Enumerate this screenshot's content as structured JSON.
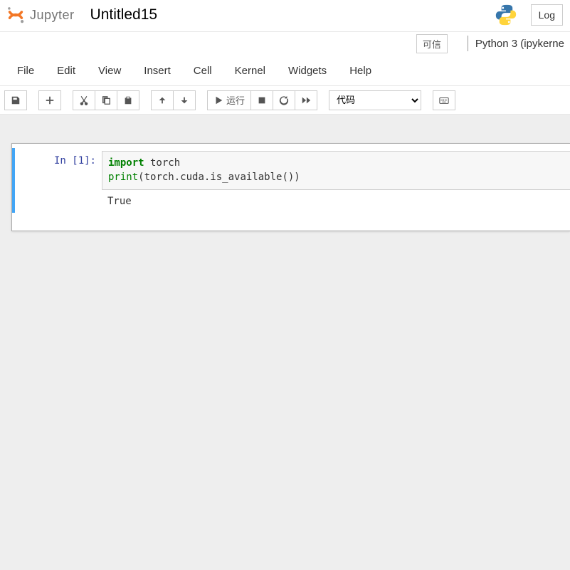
{
  "header": {
    "logo_text": "Jupyter",
    "title": "Untitled15",
    "login_label": "Log"
  },
  "status": {
    "trust": "可信",
    "kernel": "Python 3 (ipykerne"
  },
  "menubar": [
    "File",
    "Edit",
    "View",
    "Insert",
    "Cell",
    "Kernel",
    "Widgets",
    "Help"
  ],
  "toolbar": {
    "run_label": "运行",
    "celltype": "代码"
  },
  "cell": {
    "prompt": "In [1]:",
    "code_tokens": [
      {
        "t": "import",
        "c": "cm-keyword"
      },
      {
        "t": " torch",
        "c": "cm-text"
      },
      {
        "t": "\n",
        "c": ""
      },
      {
        "t": "print",
        "c": "cm-builtin"
      },
      {
        "t": "(torch.cuda.is_available())",
        "c": "cm-text"
      }
    ],
    "output": "True"
  }
}
